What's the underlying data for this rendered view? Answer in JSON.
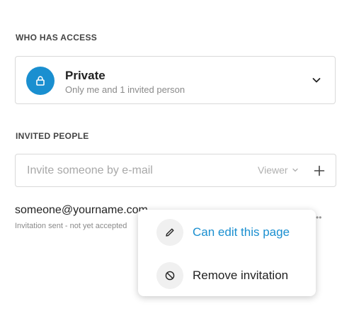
{
  "access": {
    "section_label": "WHO HAS ACCESS",
    "title": "Private",
    "subtitle": "Only me and 1 invited person",
    "icon": "lock-icon",
    "icon_bg": "#1a8fd0"
  },
  "invited": {
    "section_label": "INVITED PEOPLE",
    "input_placeholder": "Invite someone by e-mail",
    "input_value": "",
    "role": "Viewer",
    "add_icon": "plus-icon"
  },
  "person": {
    "email": "someone@yourname.com",
    "status": "Invitation sent - not yet accepted"
  },
  "menu": {
    "items": [
      {
        "label": "Can edit this page",
        "icon": "pencil-icon",
        "color": "#1a8fd0"
      },
      {
        "label": "Remove invitation",
        "icon": "block-icon",
        "color": "#222222"
      }
    ]
  }
}
